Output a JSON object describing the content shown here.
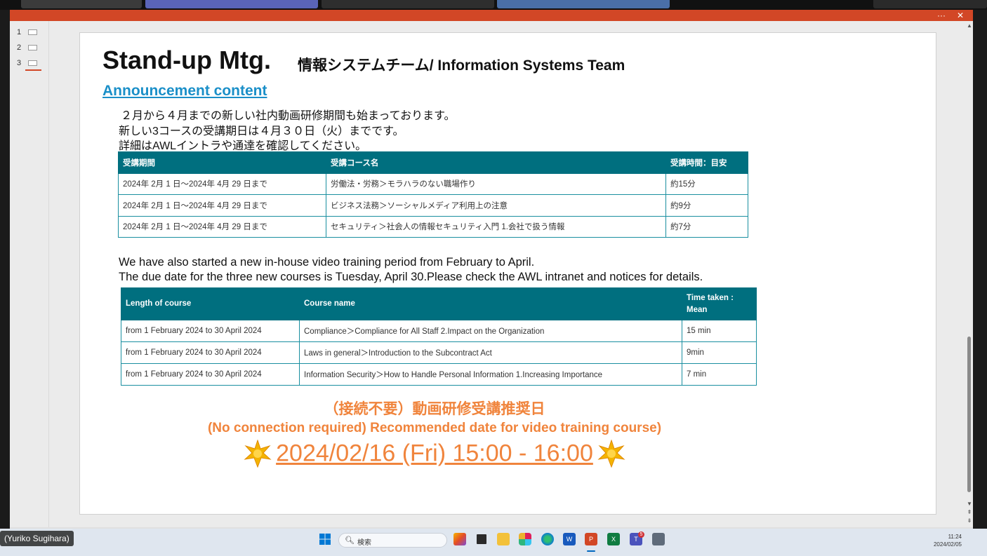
{
  "window": {
    "more_label": "···",
    "close_label": "✕"
  },
  "thumbnails": [
    {
      "number": "1"
    },
    {
      "number": "2"
    },
    {
      "number": "3"
    }
  ],
  "slide": {
    "title": "Stand-up Mtg.",
    "subtitle": "情報システムチーム/ Information Systems Team",
    "section_heading": "Announcement content",
    "jp_lines": [
      "２月から４月までの新しい社内動画研修期間も始まっております。",
      "新しい3コースの受講期日は４月３０日（火）までです。",
      "詳細はAWLイントラや通達を確認してください。"
    ],
    "jp_table": {
      "headers": [
        "受講期間",
        "受講コース名",
        "受講時間：目安"
      ],
      "rows": [
        [
          "2024年 2月 1 日～2024年 4月 29 日まで",
          "労働法・労務＞モラハラのない職場作り",
          "約15分"
        ],
        [
          "2024年 2月 1 日～2024年 4月 29 日まで",
          "ビジネス法務＞ソーシャルメディア利用上の注意",
          "約9分"
        ],
        [
          "2024年 2月 1 日～2024年 4月 29 日まで",
          "セキュリティ＞社会人の情報セキュリティ入門 1.会社で扱う情報",
          "約7分"
        ]
      ]
    },
    "en_lines": [
      "We have also started a new in-house video training period from February to April.",
      "The due date for the three new courses is Tuesday, April 30.Please check the AWL intranet and notices for details."
    ],
    "en_table": {
      "headers": [
        "Length of course",
        "Course name",
        "Time taken :",
        "Mean"
      ],
      "rows": [
        [
          "from 1 February 2024 to 30 April 2024",
          "Compliance＞Compliance for All Staff 2.Impact on the Organization",
          "15 min"
        ],
        [
          "from 1 February 2024 to 30 April 2024",
          "Laws in general＞Introduction to the Subcontract Act",
          "9min"
        ],
        [
          "from 1 February 2024 to 30 April 2024",
          "Information Security＞How to Handle Personal Information 1.Increasing Importance",
          "7 min"
        ]
      ]
    },
    "recommend_jp": "（接続不要）動画研修受講推奨日",
    "recommend_en": "(No connection required) Recommended date for video training course)",
    "recommend_date": "2024/02/16 (Fri) 15:00 - 16:00"
  },
  "taskbar": {
    "participant_name": "(Yuriko Sugihara)",
    "search_placeholder": "検索",
    "teams_badge": "5",
    "time": "11:24",
    "date": "2024/02/05"
  },
  "colors": {
    "accent": "#d24726",
    "heading_blue": "#1a8fc8",
    "table_header": "#006f7f",
    "highlight_orange": "#f0843c"
  }
}
